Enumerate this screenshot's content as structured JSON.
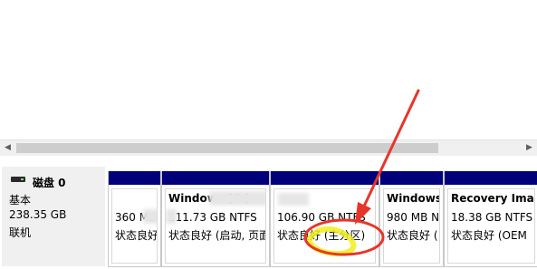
{
  "disk": {
    "title": "磁盘 0",
    "type": "基本",
    "size": "238.35 GB",
    "status": "联机"
  },
  "partitions": [
    {
      "name": "",
      "size": "360 MB",
      "state": "状态良好"
    },
    {
      "name": "Windows (C:)",
      "size": "111.73 GB NTFS",
      "state": "状态良好 (启动, 页面"
    },
    {
      "name": "",
      "size": "106.90 GB NTFS",
      "state": "状态良好 (主分区)"
    },
    {
      "name": "Windows",
      "size": "980 MB N",
      "state": "状态良好 ("
    },
    {
      "name": "Recovery Imag",
      "size": "18.38 GB NTFS",
      "state": "状态良好 (OEM"
    }
  ],
  "colors": {
    "primary_partition_bar": "#00007a",
    "annotation_arrow": "#e8352a",
    "annotation_circle": "#e8352a",
    "highlighter": "#f2ef1a"
  },
  "icons": {
    "scroll_left": "triangle-left",
    "scroll_right": "triangle-right",
    "disk": "hard-disk"
  }
}
